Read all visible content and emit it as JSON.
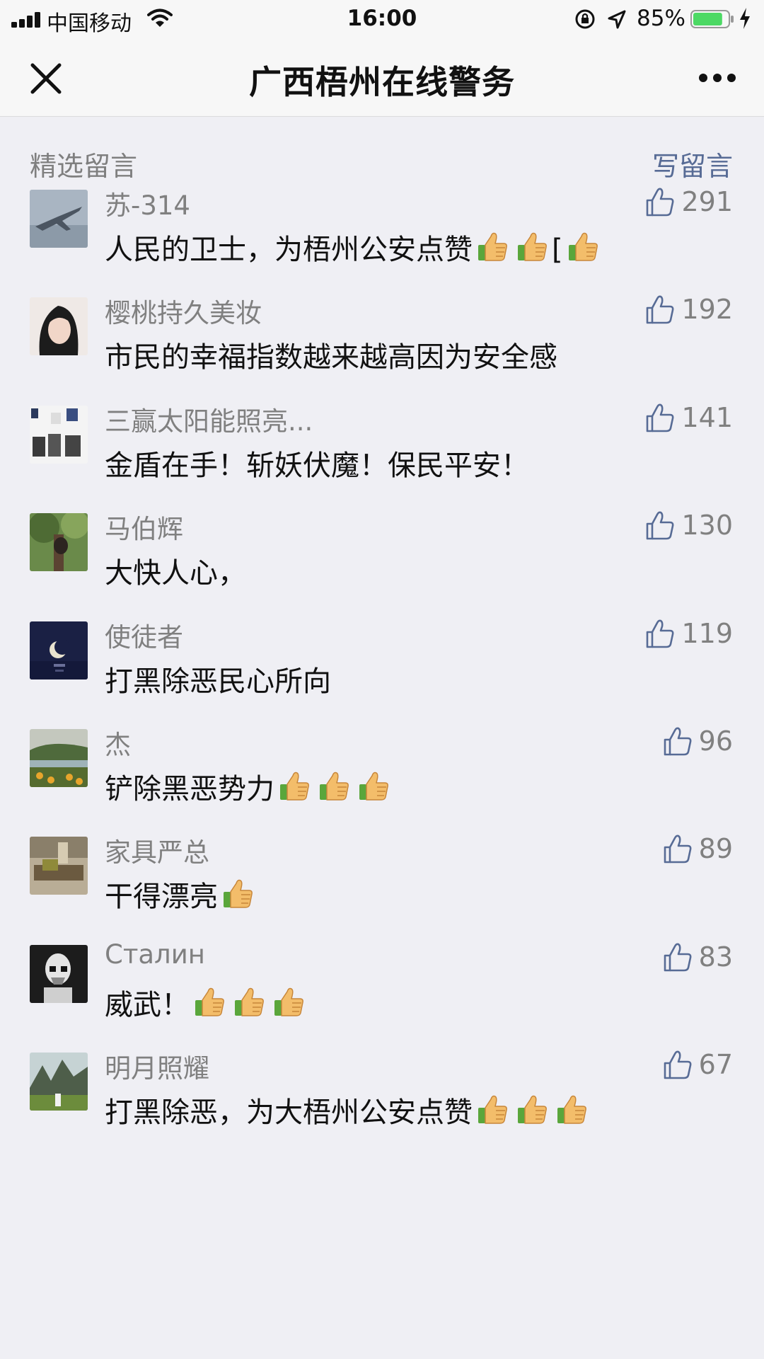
{
  "status_bar": {
    "carrier": "中国移动",
    "time": "16:00",
    "battery": "85%",
    "battery_level": 0.85
  },
  "nav": {
    "title": "广西梧州在线警务"
  },
  "section": {
    "title": "精选留言",
    "write": "写留言"
  },
  "comments": [
    {
      "nick": "苏-314",
      "text": "人民的卫士，为梧州公安点赞",
      "suffix": "[",
      "emojis": 2,
      "trailing_emojis": 1,
      "likes": "291",
      "avatar": "jet"
    },
    {
      "nick": "樱桃持久美妆",
      "text": "市民的幸福指数越来越高因为安全感",
      "emojis": 0,
      "likes": "192",
      "avatar": "woman"
    },
    {
      "nick": "三赢太阳能照亮...",
      "text": "金盾在手！斩妖伏魔！保民平安！",
      "emojis": 0,
      "likes": "141",
      "avatar": "products"
    },
    {
      "nick": "马伯辉",
      "text": "大快人心，",
      "emojis": 0,
      "likes": "130",
      "avatar": "tree"
    },
    {
      "nick": "使徒者",
      "text": "打黑除恶民心所向",
      "emojis": 0,
      "likes": "119",
      "avatar": "moon"
    },
    {
      "nick": "杰",
      "text": "铲除黑恶势力",
      "emojis": 3,
      "likes": "96",
      "avatar": "landscape"
    },
    {
      "nick": "家具严总",
      "text": "干得漂亮",
      "emojis": 1,
      "likes": "89",
      "avatar": "furniture"
    },
    {
      "nick": "Сталин",
      "text": "威武！",
      "emojis": 3,
      "likes": "83",
      "avatar": "stormtrooper"
    },
    {
      "nick": "明月照耀",
      "text": "打黑除恶，为大梧州公安点赞",
      "emojis": 3,
      "likes": "67",
      "avatar": "mountain"
    }
  ]
}
